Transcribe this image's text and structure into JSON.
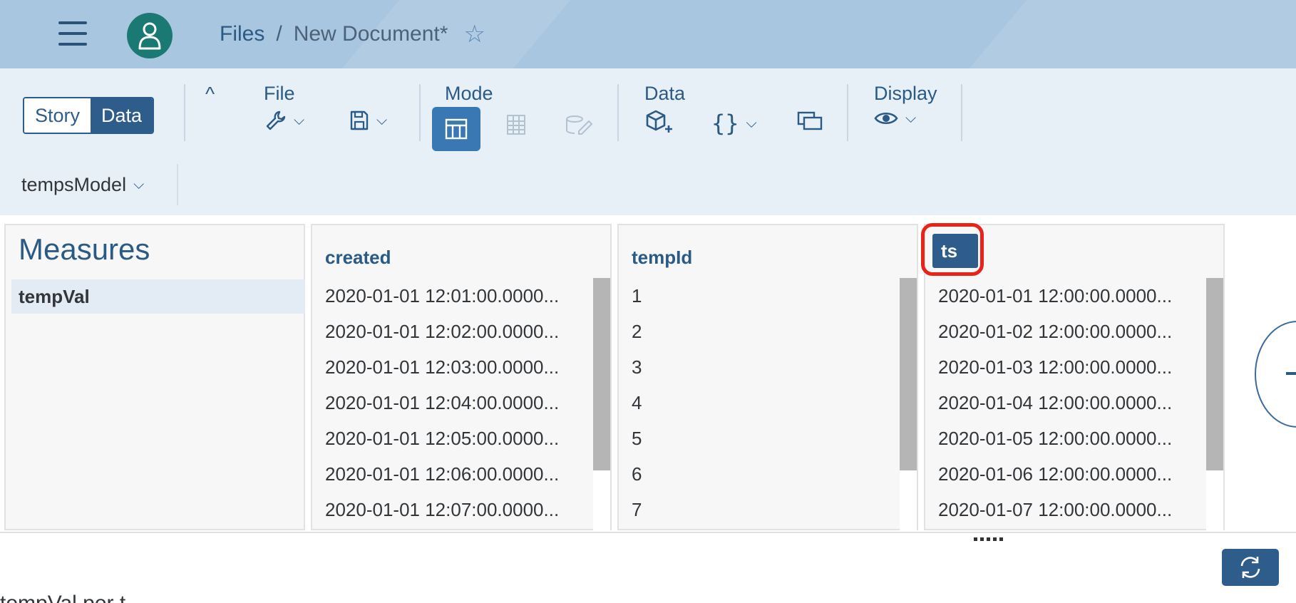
{
  "shell": {
    "breadcrumb_root": "Files",
    "breadcrumb_sep": "/",
    "document_title": "New Document*",
    "star_glyph": "☆"
  },
  "toolbar": {
    "view_story": "Story",
    "view_data": "Data",
    "collapse_glyph": "^",
    "file_label": "File",
    "mode_label": "Mode",
    "data_label": "Data",
    "display_label": "Display",
    "chevron": "⌵",
    "model_name": "tempsModel"
  },
  "measures": {
    "title": "Measures",
    "items": [
      "tempVal"
    ]
  },
  "columns": [
    {
      "header": "created",
      "rows": [
        "2020-01-01 12:01:00.0000...",
        "2020-01-01 12:02:00.0000...",
        "2020-01-01 12:03:00.0000...",
        "2020-01-01 12:04:00.0000...",
        "2020-01-01 12:05:00.0000...",
        "2020-01-01 12:06:00.0000...",
        "2020-01-01 12:07:00.0000..."
      ]
    },
    {
      "header": "tempId",
      "rows": [
        "1",
        "2",
        "3",
        "4",
        "5",
        "6",
        "7"
      ]
    },
    {
      "header": "ts",
      "rows": [
        "2020-01-01 12:00:00.0000...",
        "2020-01-02 12:00:00.0000...",
        "2020-01-03 12:00:00.0000...",
        "2020-01-04 12:00:00.0000...",
        "2020-01-05 12:00:00.0000...",
        "2020-01-06 12:00:00.0000...",
        "2020-01-07 12:00:00.0000..."
      ]
    }
  ],
  "bottom": {
    "partial_text": "tempVal per t"
  },
  "colors": {
    "shell_bg": "#a9c6e0",
    "toolbar_bg": "#e7eff7",
    "accent": "#2e5d8c",
    "avatar": "#1a7a73",
    "highlight": "#e8241a"
  },
  "icons": [
    "menu-icon",
    "user-icon",
    "star-icon",
    "wrench-icon",
    "save-icon",
    "table-layout-icon",
    "grid-icon",
    "edit-icon",
    "add-cube-icon",
    "braces-icon",
    "window-icon",
    "eye-icon",
    "refresh-icon"
  ]
}
